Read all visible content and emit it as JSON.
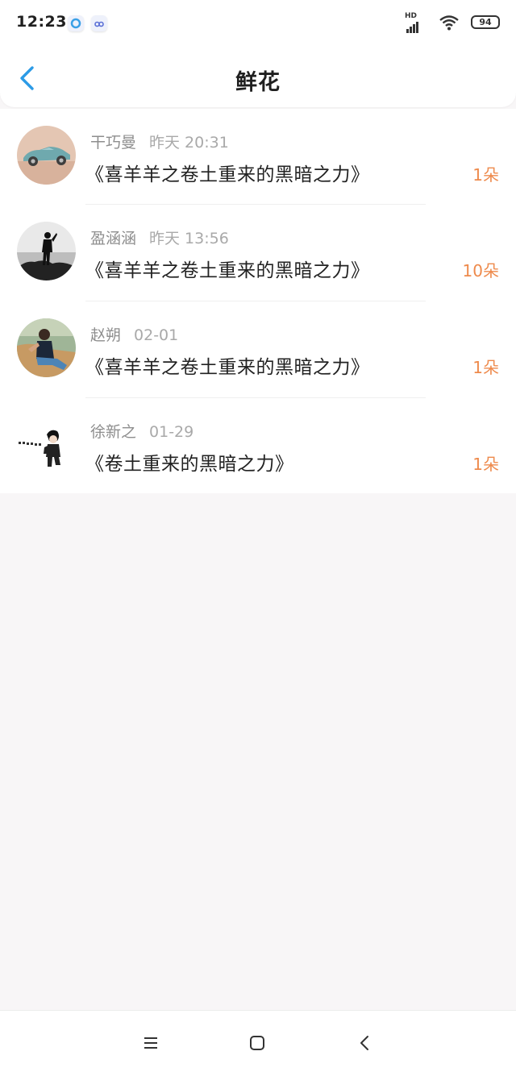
{
  "status_bar": {
    "time": "12:23",
    "network_label": "HD",
    "battery": "94",
    "icons": [
      "app-icon",
      "app-icon",
      "signal-icon",
      "wifi-icon",
      "battery-icon"
    ]
  },
  "header": {
    "title": "鲜花",
    "back_icon": "chevron-left-icon",
    "accent_color": "#2c9be6"
  },
  "items": [
    {
      "name": "干巧曼",
      "time": "昨天 20:31",
      "title": "《喜羊羊之卷土重来的黑暗之力》",
      "count": "1朵",
      "avatar": "vintage-car-avatar"
    },
    {
      "name": "盈涵涵",
      "time": "昨天 13:56",
      "title": "《喜羊羊之卷土重来的黑暗之力》",
      "count": "10朵",
      "avatar": "silhouette-sea-avatar"
    },
    {
      "name": "赵朔",
      "time": "02-01",
      "title": "《喜羊羊之卷土重来的黑暗之力》",
      "count": "1朵",
      "avatar": "person-sofa-avatar"
    },
    {
      "name": "徐新之",
      "time": "01-29",
      "title": "《卷土重来的黑暗之力》",
      "count": "1朵",
      "avatar": "cartoon-figure-avatar"
    }
  ],
  "colors": {
    "count": "#ee8a4c",
    "background": "#f8f6f7"
  },
  "bottom_nav": {
    "icons": [
      "menu-icon",
      "home-icon",
      "back-icon"
    ]
  }
}
